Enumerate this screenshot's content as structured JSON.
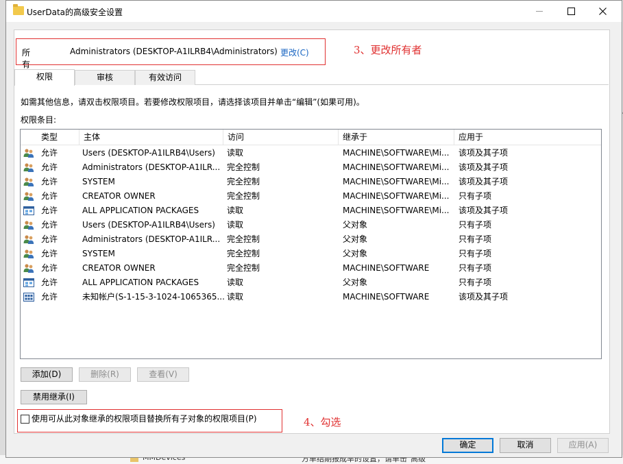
{
  "window": {
    "title": "UserData的高级安全设置"
  },
  "owner": {
    "label": "所有者:",
    "value": "Administrators (DESKTOP-A1ILRB4\\Administrators)",
    "change_link": "更改(C)"
  },
  "annotations": {
    "step3": "3、更改所有者",
    "step4": "4、勾选"
  },
  "tabs": [
    {
      "label": "权限",
      "active": true
    },
    {
      "label": "审核",
      "active": false
    },
    {
      "label": "有效访问",
      "active": false
    }
  ],
  "info_text": "如需其他信息，请双击权限项目。若要修改权限项目，请选择该项目并单击“编辑”(如果可用)。",
  "entries_label": "权限条目:",
  "columns": [
    "类型",
    "主体",
    "访问",
    "继承于",
    "应用于"
  ],
  "rows": [
    {
      "icon": "users-icon",
      "type": "允许",
      "principal": "Users (DESKTOP-A1ILRB4\\Users)",
      "access": "读取",
      "inherited": "MACHINE\\SOFTWARE\\Mi...",
      "applies": "该项及其子项"
    },
    {
      "icon": "users-icon",
      "type": "允许",
      "principal": "Administrators (DESKTOP-A1ILR...",
      "access": "完全控制",
      "inherited": "MACHINE\\SOFTWARE\\Mi...",
      "applies": "该项及其子项"
    },
    {
      "icon": "users-icon",
      "type": "允许",
      "principal": "SYSTEM",
      "access": "完全控制",
      "inherited": "MACHINE\\SOFTWARE\\Mi...",
      "applies": "该项及其子项"
    },
    {
      "icon": "users-icon",
      "type": "允许",
      "principal": "CREATOR OWNER",
      "access": "完全控制",
      "inherited": "MACHINE\\SOFTWARE\\Mi...",
      "applies": "只有子项"
    },
    {
      "icon": "package-icon",
      "type": "允许",
      "principal": "ALL APPLICATION PACKAGES",
      "access": "读取",
      "inherited": "MACHINE\\SOFTWARE\\Mi...",
      "applies": "该项及其子项"
    },
    {
      "icon": "users-icon",
      "type": "允许",
      "principal": "Users (DESKTOP-A1ILRB4\\Users)",
      "access": "读取",
      "inherited": "父对象",
      "applies": "只有子项"
    },
    {
      "icon": "users-icon",
      "type": "允许",
      "principal": "Administrators (DESKTOP-A1ILR...",
      "access": "完全控制",
      "inherited": "父对象",
      "applies": "只有子项"
    },
    {
      "icon": "users-icon",
      "type": "允许",
      "principal": "SYSTEM",
      "access": "完全控制",
      "inherited": "父对象",
      "applies": "只有子项"
    },
    {
      "icon": "users-icon",
      "type": "允许",
      "principal": "CREATOR OWNER",
      "access": "完全控制",
      "inherited": "MACHINE\\SOFTWARE",
      "applies": "只有子项"
    },
    {
      "icon": "package-icon",
      "type": "允许",
      "principal": "ALL APPLICATION PACKAGES",
      "access": "读取",
      "inherited": "父对象",
      "applies": "只有子项"
    },
    {
      "icon": "unknown-account-icon",
      "type": "允许",
      "principal": "未知帐户(S-1-15-3-1024-1065365...",
      "access": "读取",
      "inherited": "MACHINE\\SOFTWARE",
      "applies": "该项及其子项"
    }
  ],
  "buttons": {
    "add": "添加(D)",
    "remove": "删除(R)",
    "view": "查看(V)",
    "disable_inheritance": "禁用继承(I)",
    "ok": "确定",
    "cancel": "取消",
    "apply": "应用(A)"
  },
  "replace_checkbox": {
    "label": "使用可从此对象继承的权限项目替换所有子对象的权限项目(P)",
    "checked": false
  },
  "background": {
    "folder_label": "MMDevices",
    "right_text": "方单结期报成率的设置，请单击\"高级\""
  }
}
